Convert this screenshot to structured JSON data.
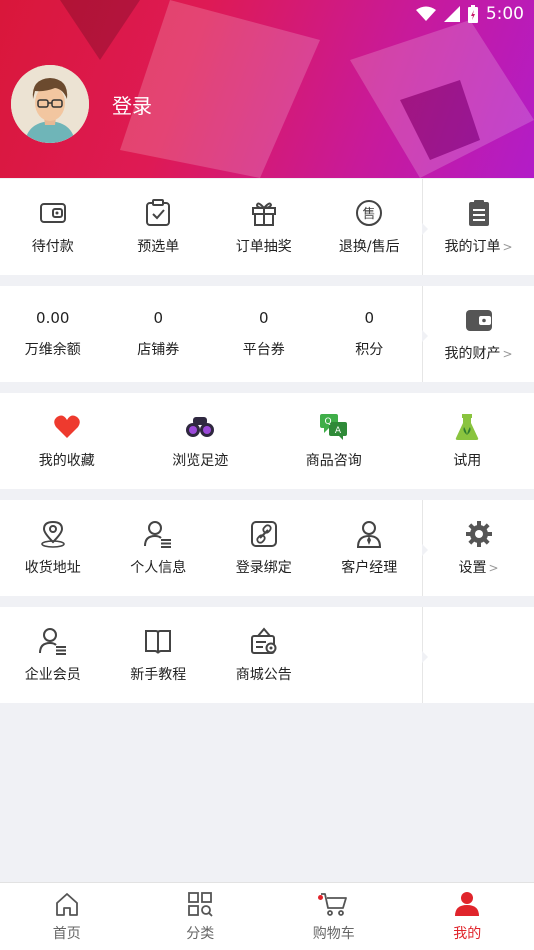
{
  "status_bar": {
    "time": "5:00"
  },
  "profile": {
    "login_label": "登录"
  },
  "orders": {
    "items": [
      {
        "label": "待付款",
        "icon": "wallet-icon"
      },
      {
        "label": "预选单",
        "icon": "clipboard-check-icon"
      },
      {
        "label": "订单抽奖",
        "icon": "gift-icon"
      },
      {
        "label": "退换/售后",
        "icon": "after-sale-icon"
      }
    ],
    "side": {
      "label": "我的订单",
      "icon": "order-list-icon"
    }
  },
  "assets": {
    "items": [
      {
        "value": "0.00",
        "label": "万维余额"
      },
      {
        "value": "0",
        "label": "店铺券"
      },
      {
        "value": "0",
        "label": "平台券"
      },
      {
        "value": "0",
        "label": "积分"
      }
    ],
    "side": {
      "label": "我的财产",
      "icon": "purse-icon"
    }
  },
  "activity": {
    "items": [
      {
        "label": "我的收藏",
        "icon": "heart-icon"
      },
      {
        "label": "浏览足迹",
        "icon": "binoculars-icon"
      },
      {
        "label": "商品咨询",
        "icon": "chat-icon"
      },
      {
        "label": "试用",
        "icon": "flask-icon"
      }
    ]
  },
  "account": {
    "items": [
      {
        "label": "收货地址",
        "icon": "location-pin-icon"
      },
      {
        "label": "个人信息",
        "icon": "user-info-icon"
      },
      {
        "label": "登录绑定",
        "icon": "link-icon"
      },
      {
        "label": "客户经理",
        "icon": "manager-icon"
      }
    ],
    "side": {
      "label": "设置",
      "icon": "gear-icon"
    }
  },
  "more": {
    "items": [
      {
        "label": "企业会员",
        "icon": "enterprise-user-icon"
      },
      {
        "label": "新手教程",
        "icon": "book-icon"
      },
      {
        "label": "商城公告",
        "icon": "notice-icon"
      }
    ]
  },
  "tabbar": {
    "items": [
      {
        "label": "首页",
        "icon": "home-icon"
      },
      {
        "label": "分类",
        "icon": "category-icon"
      },
      {
        "label": "购物车",
        "icon": "cart-icon"
      },
      {
        "label": "我的",
        "icon": "person-icon"
      }
    ],
    "active_index": 3
  },
  "colors": {
    "accent": "#e0242b",
    "header_start": "#d9173a",
    "header_end": "#b21cc8"
  }
}
